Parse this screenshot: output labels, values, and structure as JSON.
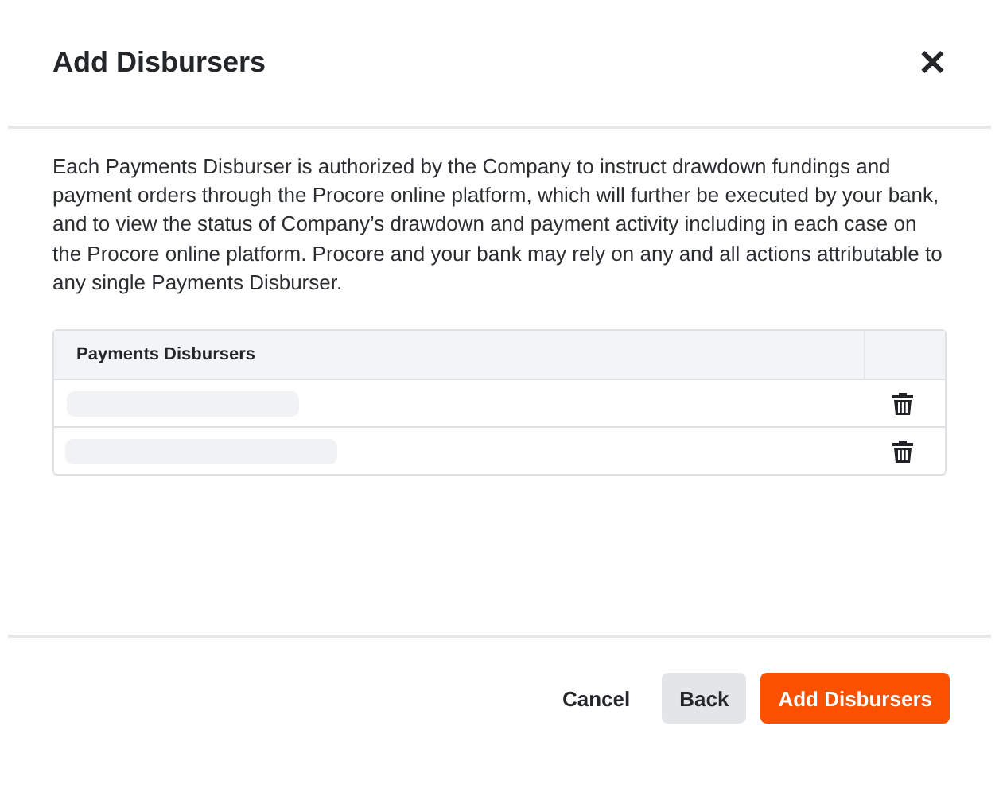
{
  "dialog": {
    "title": "Add Disbursers",
    "close_icon": "✕"
  },
  "description": "Each Payments Disburser is authorized by the Company to instruct drawdown fundings and payment orders through the Procore online platform, which will further be executed by your bank, and to view the status of Company’s drawdown and payment activity including in each case on the Procore online platform. Procore and your bank may rely on any and all actions attributable to any single Payments Disburser.",
  "table": {
    "columns": [
      "Payments Disbursers"
    ],
    "rows": [
      {
        "kind": "loading"
      },
      {
        "kind": "loading"
      }
    ]
  },
  "buttons": [
    {
      "label": "Cancel",
      "kind": "tertiary"
    },
    {
      "label": "Back",
      "kind": "secondary"
    },
    {
      "label": "Add Disbursers",
      "kind": "primary"
    }
  ]
}
